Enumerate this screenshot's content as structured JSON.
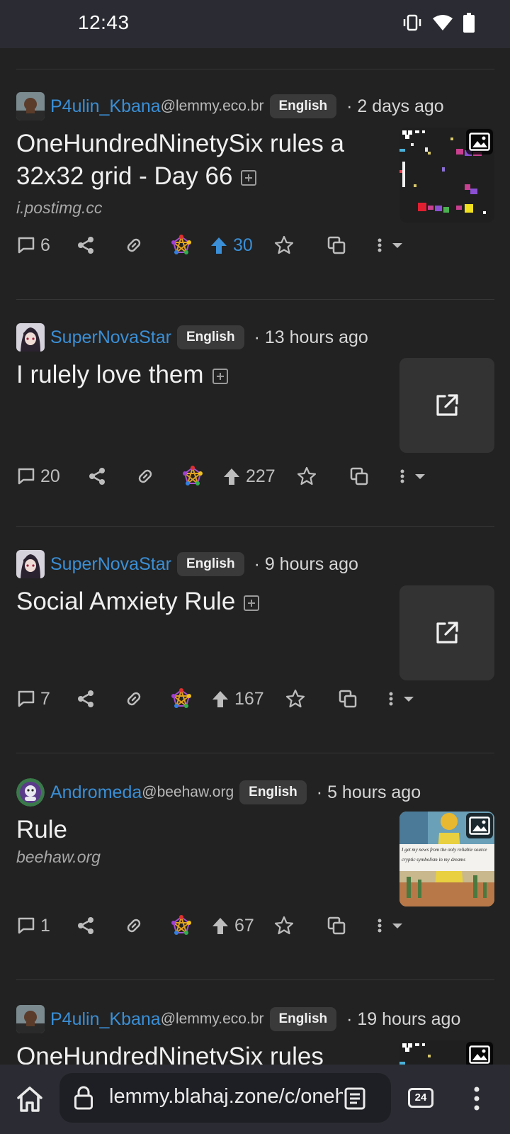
{
  "status_bar": {
    "time": "12:43"
  },
  "posts": [
    {
      "user": "P4ulin_Kbana",
      "instance": "@lemmy.eco.br",
      "language": "English",
      "time": "· 2 days ago",
      "title": "OneHundredNinetySix rules a 32x32 grid - Day 66",
      "domain": "i.postimg.cc",
      "comments": "6",
      "score": "30",
      "thumb_type": "image"
    },
    {
      "user": "SuperNovaStar",
      "instance": "",
      "language": "English",
      "time": "· 13 hours ago",
      "title": "I rulely love them",
      "domain": "",
      "comments": "20",
      "score": "227",
      "thumb_type": "link"
    },
    {
      "user": "SuperNovaStar",
      "instance": "",
      "language": "English",
      "time": "· 9 hours ago",
      "title": "Social Amxiety Rule",
      "domain": "",
      "comments": "7",
      "score": "167",
      "thumb_type": "link"
    },
    {
      "user": "Andromeda",
      "instance": "@beehaw.org",
      "language": "English",
      "time": "· 5 hours ago",
      "title": "Rule",
      "domain": "beehaw.org",
      "comments": "1",
      "score": "67",
      "thumb_type": "image",
      "thumb_caption_1": "I get my news from the only reliable source",
      "thumb_caption_2": "cryptic symbolism in my dreams"
    },
    {
      "user": "P4ulin_Kbana",
      "instance": "@lemmy.eco.br",
      "language": "English",
      "time": "· 19 hours ago",
      "title": "OneHundredNinetySix rules",
      "thumb_type": "image"
    }
  ],
  "browser": {
    "url": "lemmy.blahaj.zone/c/onehundredninetysix",
    "tab_count": "24"
  },
  "colors": {
    "accent": "#3a8fd6",
    "background": "#222222",
    "bar": "#2b2c33"
  }
}
